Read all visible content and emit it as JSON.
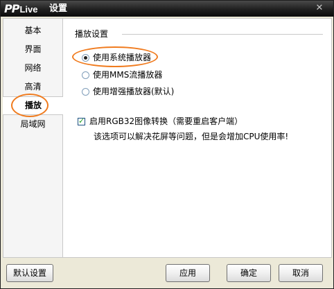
{
  "window": {
    "logo_pp": "PP",
    "logo_live": "Live",
    "title": "设置",
    "close_glyph": "✕"
  },
  "sidebar": {
    "items": [
      {
        "label": "基本"
      },
      {
        "label": "界面"
      },
      {
        "label": "网络"
      },
      {
        "label": "高清"
      },
      {
        "label": "播放",
        "active": true
      },
      {
        "label": "局域网"
      }
    ]
  },
  "content": {
    "section_title": "播放设置",
    "player_options": [
      {
        "label": "使用系统播放器",
        "checked": true
      },
      {
        "label": "使用MMS流播放器",
        "checked": false
      },
      {
        "label": "使用增强播放器(默认)",
        "checked": false
      }
    ],
    "rgb32": {
      "label": "启用RGB32图像转换（需要重启客户端）",
      "checked": true,
      "check_glyph": "✓",
      "description": "该选项可以解决花屏等问题，但是会增加CPU使用率!"
    }
  },
  "buttons": {
    "default": "默认设置",
    "apply": "应用",
    "ok": "确定",
    "cancel": "取消"
  },
  "colors": {
    "highlight": "#f07b1e",
    "titlebar": "#1f1f1f",
    "checkmark": "#21a121"
  }
}
